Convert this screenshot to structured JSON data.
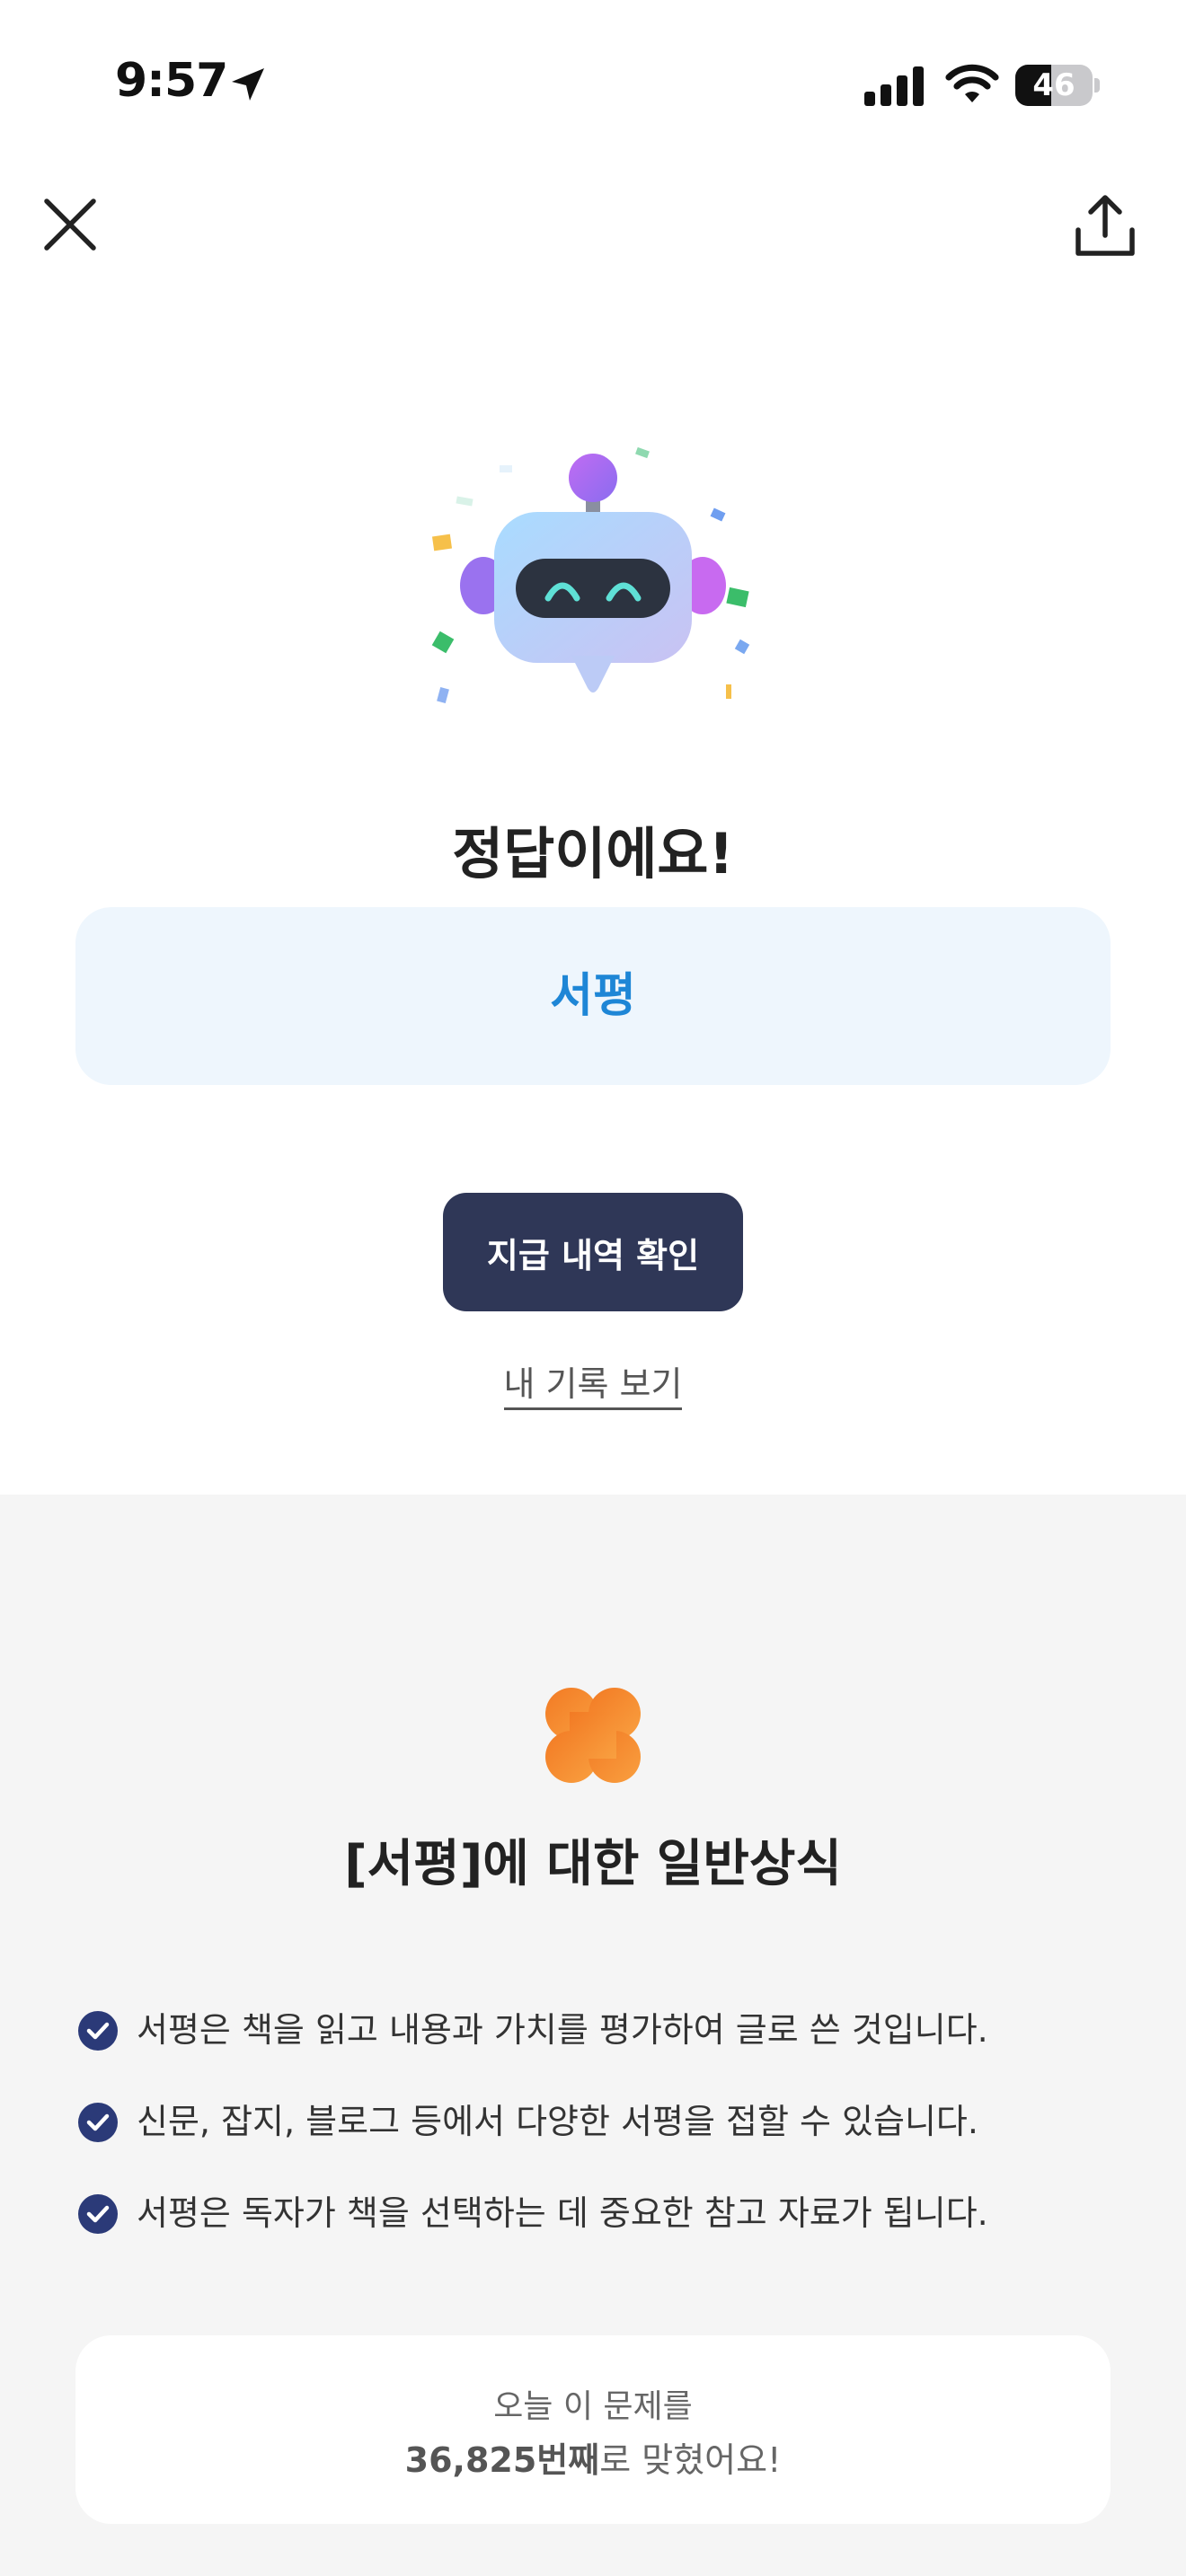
{
  "status_bar": {
    "time": "9:57",
    "battery_percent": "46",
    "battery_level": 0.46
  },
  "nav": {
    "close_icon": "close-icon",
    "share_icon": "share-icon"
  },
  "result": {
    "title": "정답이에요!",
    "answer": "서평"
  },
  "actions": {
    "primary_label": "지급 내역 확인",
    "history_link": "내 기록 보기"
  },
  "knowledge": {
    "title": "[서평]에 대한 일반상식",
    "facts": [
      "서평은 책을 읽고 내용과 가치를 평가하여 글로 쓴 것입니다.",
      "신문, 잡지, 블로그 등에서 다양한 서평을 접할 수 있습니다.",
      "서평은 독자가 책을 선택하는 데 중요한 참고 자료가 됩니다."
    ]
  },
  "stats": {
    "line1": "오늘 이 문제를",
    "count": "36,825번째",
    "suffix": "로 맞혔어요!"
  },
  "colors": {
    "accent_blue": "#1e86d6",
    "answer_bg": "#eef6fd",
    "primary_button": "#2f3757",
    "check": "#2b3a78",
    "clover": "#f5892a",
    "section_bg": "#f5f5f5"
  }
}
